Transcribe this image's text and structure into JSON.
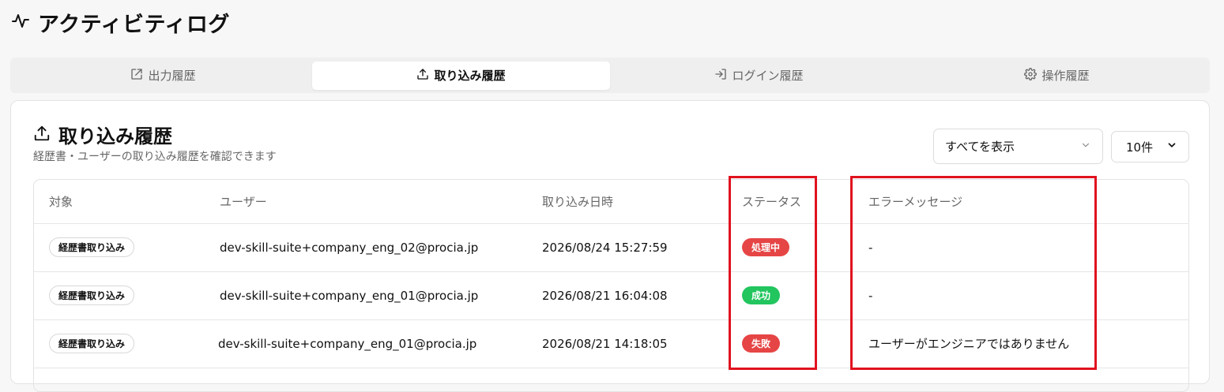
{
  "header": {
    "title": "アクティビティログ",
    "icon": "activity-icon"
  },
  "tabs": [
    {
      "label": "出力履歴",
      "icon": "external-link-icon",
      "active": false
    },
    {
      "label": "取り込み履歴",
      "icon": "upload-icon",
      "active": true
    },
    {
      "label": "ログイン履歴",
      "icon": "login-icon",
      "active": false
    },
    {
      "label": "操作履歴",
      "icon": "gear-icon",
      "active": false
    }
  ],
  "card": {
    "title": "取り込み履歴",
    "subtitle": "経歴書・ユーザーの取り込み履歴を確認できます",
    "filter_value": "すべてを表示",
    "count_value": "10件"
  },
  "table": {
    "columns": [
      "対象",
      "ユーザー",
      "取り込み日時",
      "ステータス",
      "エラーメッセージ"
    ],
    "rows": [
      {
        "target": "経歴書取り込み",
        "user": "dev-skill-suite+company_eng_02@procia.jp",
        "datetime": "2026/08/24 15:27:59",
        "status": "処理中",
        "status_color": "#e64545",
        "error": "-"
      },
      {
        "target": "経歴書取り込み",
        "user": "dev-skill-suite+company_eng_01@procia.jp",
        "datetime": "2026/08/21 16:04:08",
        "status": "成功",
        "status_color": "#22c55e",
        "error": "-"
      },
      {
        "target": "経歴書取り込み",
        "user": "dev-skill-suite+company_eng_01@procia.jp",
        "datetime": "2026/08/21 14:18:05",
        "status": "失敗",
        "status_color": "#e64545",
        "error": "ユーザーがエンジニアではありません"
      }
    ]
  },
  "colors": {
    "highlight": "#e0121f"
  }
}
